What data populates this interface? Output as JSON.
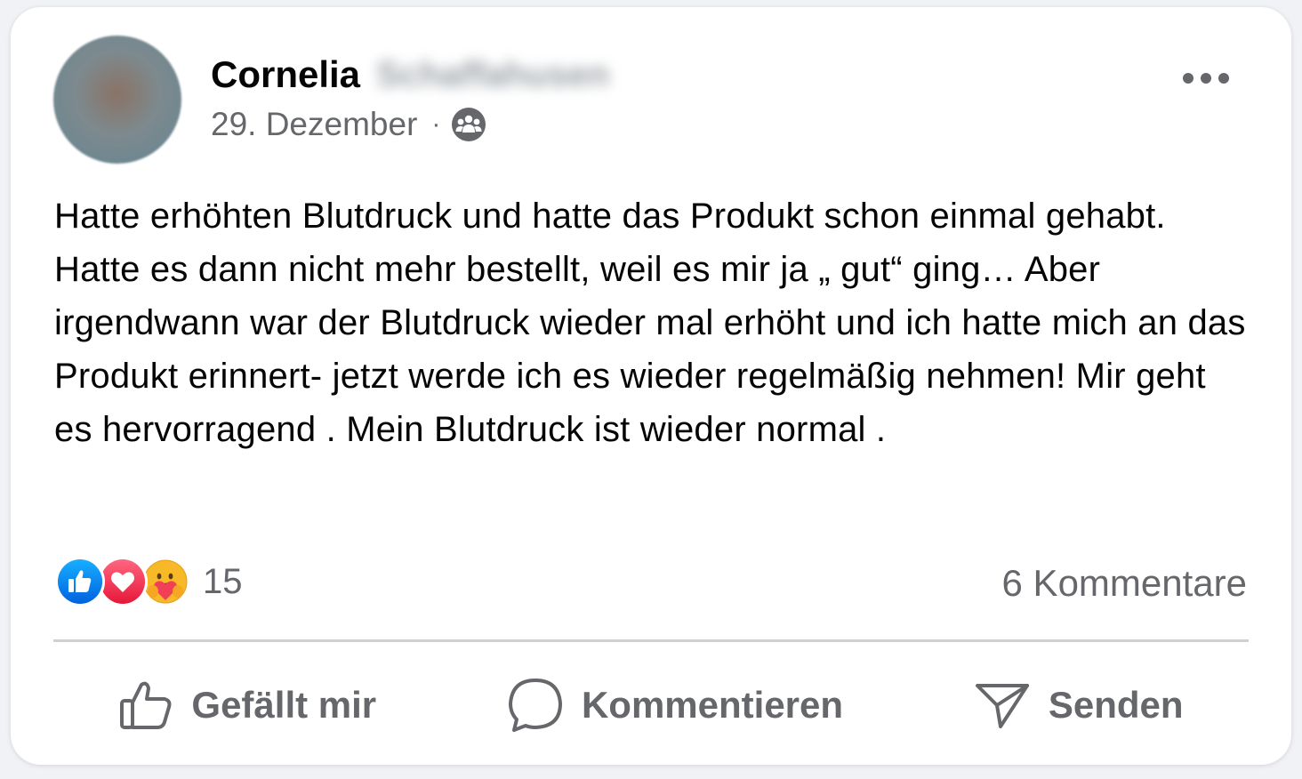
{
  "post": {
    "author_first": "Cornelia",
    "author_last_blurred": "Schaffahusen",
    "date": "29. Dezember",
    "separator": "·",
    "audience_icon": "group-audience-icon",
    "text": "Hatte erhöhten Blutdruck und hatte das Produkt schon einmal gehabt. Hatte es dann nicht mehr bestellt, weil es mir ja „ gut“ ging… Aber irgendwann war der Blutdruck wieder mal erhöht und ich hatte mich an das Produkt erinnert- jetzt werde ich es wieder regelmäßig nehmen! Mir geht es hervorragend . Mein Blutdruck ist wieder normal ."
  },
  "reactions": {
    "icons": [
      "like-reaction-icon",
      "love-reaction-icon",
      "care-reaction-icon"
    ],
    "count": "15"
  },
  "comments_label": "6 Kommentare",
  "actions": {
    "like": "Gefällt mir",
    "comment": "Kommentieren",
    "send": "Senden"
  },
  "colors": {
    "like_blue": "#1877f2",
    "love_red": "#f33e58",
    "care_yellow": "#f7b928",
    "secondary_text": "#65676b"
  }
}
